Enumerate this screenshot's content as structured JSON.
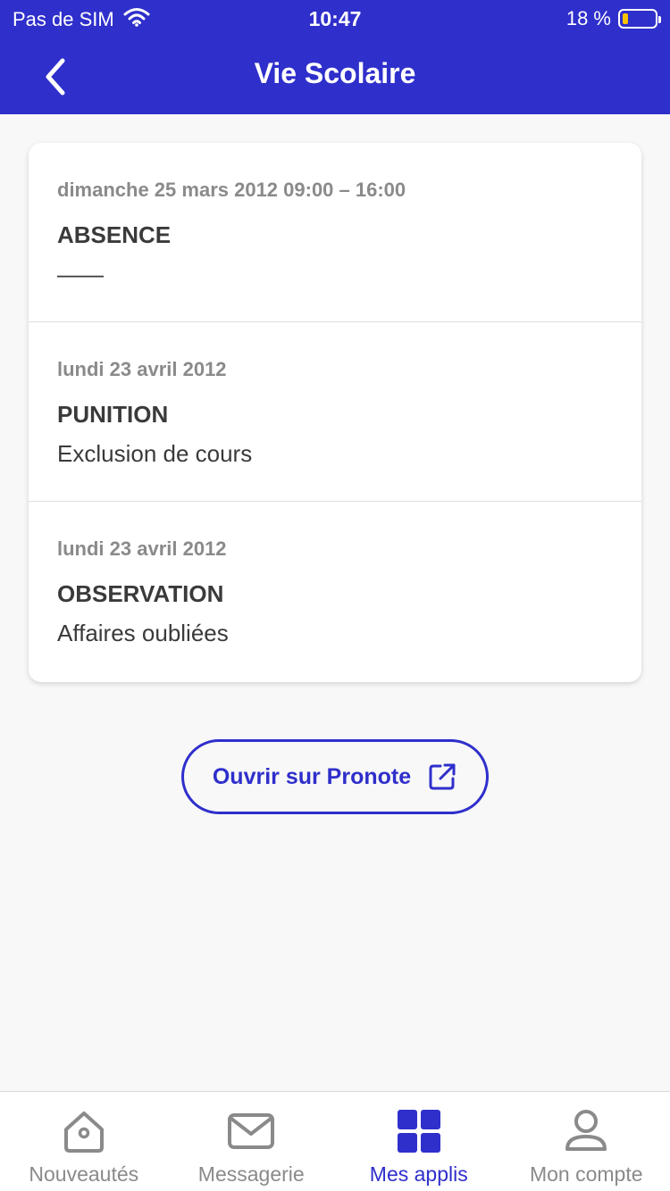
{
  "status_bar": {
    "carrier": "Pas de SIM",
    "time": "10:47",
    "battery_percent": "18 %",
    "battery_level": 0.18,
    "wifi_icon": "wifi-icon",
    "battery_icon": "battery-icon"
  },
  "header": {
    "title": "Vie Scolaire",
    "back_icon": "chevron-left-icon"
  },
  "entries": [
    {
      "date": "dimanche 25 mars 2012 09:00 – 16:00",
      "type": "ABSENCE",
      "detail": "——"
    },
    {
      "date": "lundi 23 avril 2012",
      "type": "PUNITION",
      "detail": "Exclusion de cours"
    },
    {
      "date": "lundi 23 avril 2012",
      "type": "OBSERVATION",
      "detail": "Affaires oubliées"
    }
  ],
  "open_button": {
    "label": "Ouvrir sur Pronote",
    "icon": "external-link-icon"
  },
  "bottom_nav": {
    "items": [
      {
        "label": "Nouveautés",
        "icon": "home-icon",
        "active": false
      },
      {
        "label": "Messagerie",
        "icon": "mail-icon",
        "active": false
      },
      {
        "label": "Mes applis",
        "icon": "apps-grid-icon",
        "active": true
      },
      {
        "label": "Mon compte",
        "icon": "user-icon",
        "active": false
      }
    ]
  },
  "colors": {
    "brand": "#2f2fcc",
    "background": "#f8f8f8",
    "inactive": "#8a8a8a",
    "battery_low": "#f7c400"
  }
}
